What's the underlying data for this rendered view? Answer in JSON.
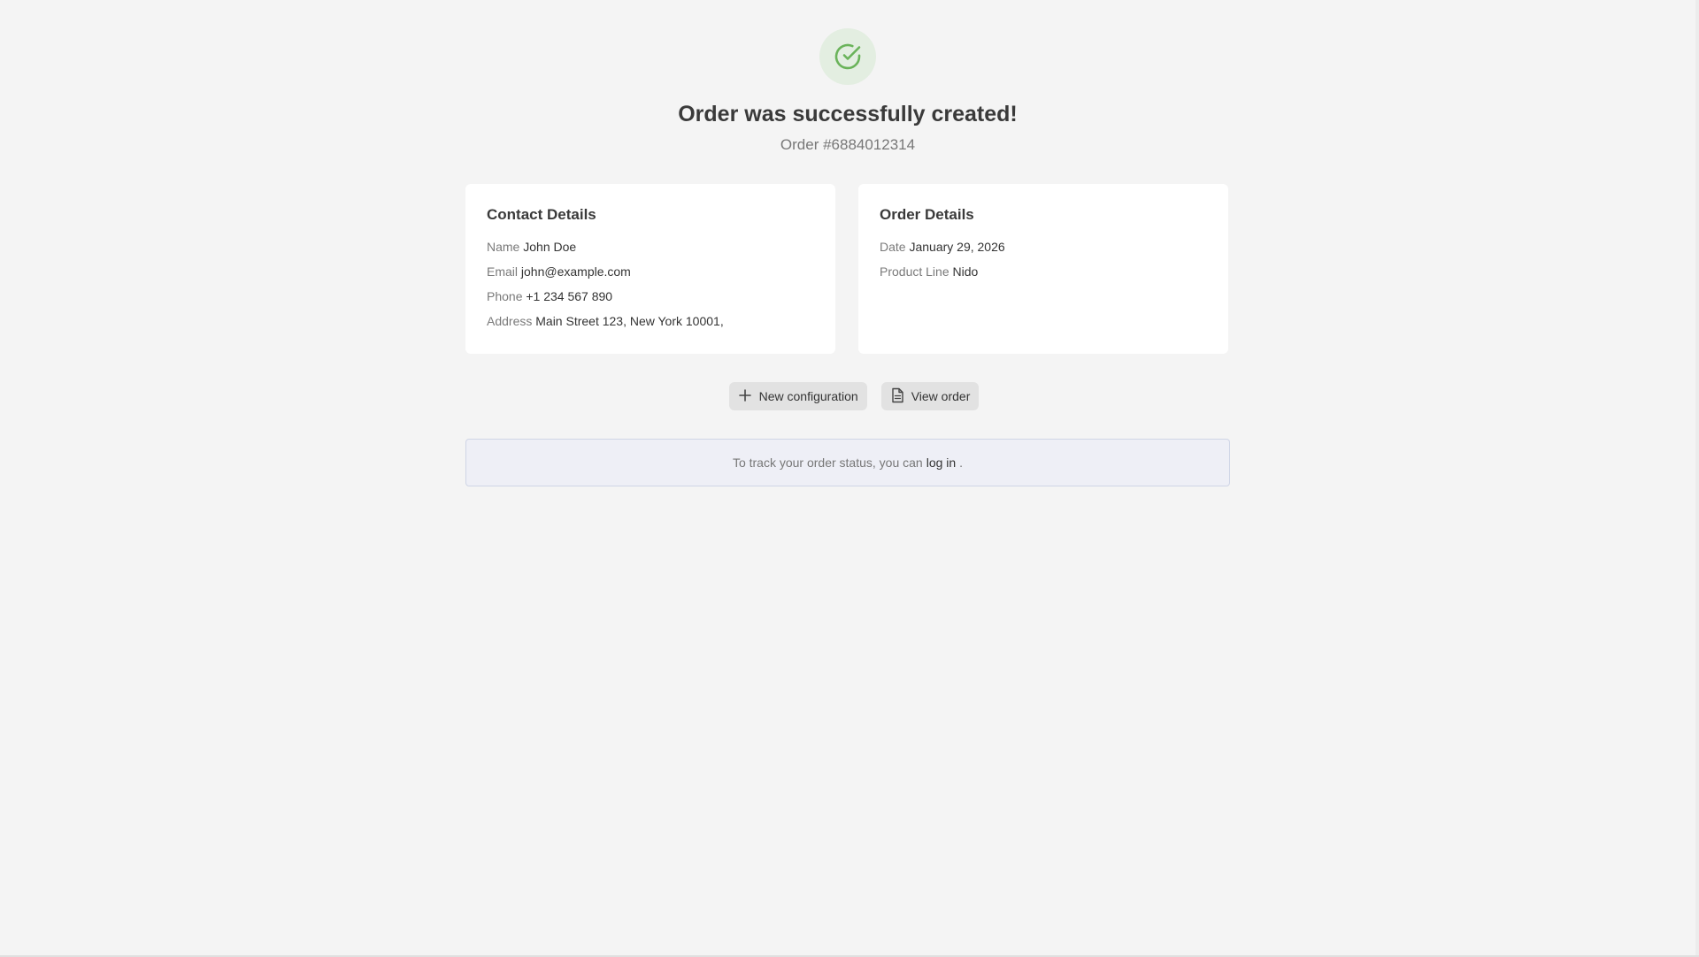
{
  "header": {
    "title": "Order was successfully created!",
    "order_number": "Order #6884012314",
    "status_icon": "check-circle-icon",
    "accent_color": "#6ab35a"
  },
  "contact": {
    "heading": "Contact Details",
    "name_label": "Name",
    "name_value": "John Doe",
    "email_label": "Email",
    "email_value": "john@example.com",
    "phone_label": "Phone",
    "phone_value": "+1 234 567 890",
    "address_label": "Address",
    "address_value": "Main Street 123, New York 10001,"
  },
  "order": {
    "heading": "Order Details",
    "date_label": "Date",
    "date_value": "January 29, 2026",
    "product_line_label": "Product Line",
    "product_line_value": "Nido"
  },
  "actions": {
    "new_configuration_label": "New configuration",
    "new_configuration_icon": "plus-icon",
    "view_order_label": "View order",
    "view_order_icon": "document-icon"
  },
  "notice": {
    "text_before": "To track your order status, you can",
    "link_label": "log in",
    "text_after": "."
  }
}
